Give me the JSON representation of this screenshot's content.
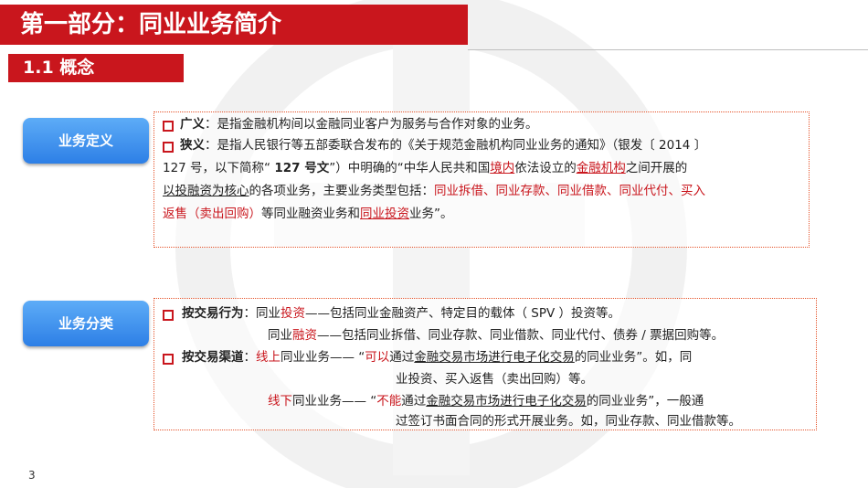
{
  "header": {
    "title": "第一部分：同业业务简介",
    "section": "1.1  概念"
  },
  "definition": {
    "pill": "业务定义",
    "broad_term": "广义",
    "broad_text": "：是指金融机构间以金融同业客户为服务与合作对象的业务。",
    "narrow_term": "狭义",
    "narrow_p1": "：是指人民银行等五部委联合发布的《关于规范金融机构同业业务的通知》（银发〔 2014 〕",
    "l2_a": "127 号，以下简称“ ",
    "l2_bold": "127 号文",
    "l2_b": "”）中明确的“中华人民共和国",
    "l2_red1": "境内",
    "l2_c": "依法设立的",
    "l2_red2": "金融机构",
    "l2_d": "之间开展的",
    "l3_ul": "以投融资为核心",
    "l3_a": "的各项业务，主要业务类型包括：",
    "l3_red": "同业拆借、同业存款、同业借款、同业代付、买入",
    "l4_red": "返售（卖出回购）",
    "l4_a": "等同业融资业务和",
    "l4_red2": "同业投资",
    "l4_b": "业务”。"
  },
  "classification": {
    "pill": "业务分类",
    "by_behavior": "按交易行为",
    "colon": "：",
    "invest_a": "同业",
    "invest_red": "投资",
    "invest_b": "——包括同业金融资产、特定目的载体（ SPV ）投资等。",
    "finance_a": "同业",
    "finance_red": "融资",
    "finance_b": "——包括同业拆借、同业存款、同业借款、同业代付、债券 / 票据回购等。",
    "by_channel": "按交易渠道",
    "online_red": "线上",
    "online_a": "同业业务——  “",
    "online_red2": "可以",
    "online_b": "通过",
    "online_ul": "金融交易市场进行电子化交易",
    "online_c": "的同业业务”。如，同",
    "online_l2": "业投资、买入返售（卖出回购）等。",
    "offline_red": "线下",
    "offline_a": "同业业务——  “",
    "offline_red2": "不能",
    "offline_b": "通过",
    "offline_ul": "金融交易市场进行电子化交易",
    "offline_c": "的同业业务”，一般通",
    "offline_l2": "过签订书面合同的形式开展业务。如，同业存款、同业借款等。"
  },
  "page_number": "3",
  "colors": {
    "brand_red": "#c9161d",
    "pill_blue": "#2d7fe6",
    "border_orange": "#e5532a"
  }
}
